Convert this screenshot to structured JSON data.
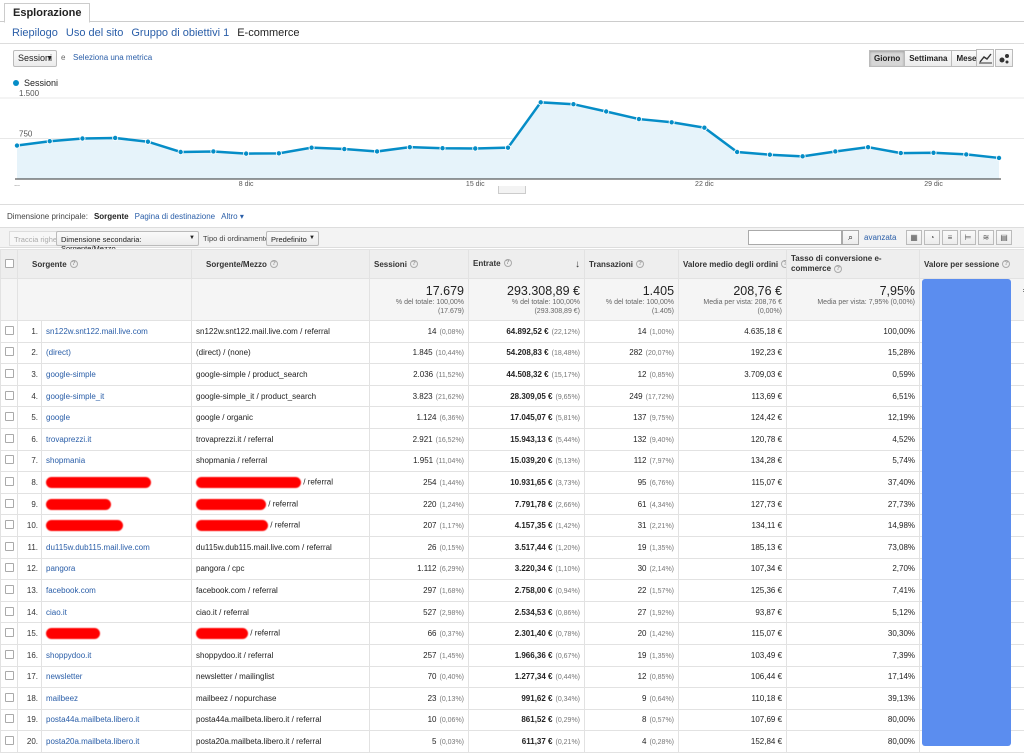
{
  "top_tab": "Esplorazione",
  "subtabs": [
    "Riepilogo",
    "Uso del sito",
    "Gruppo di obiettivi 1",
    "E-commerce"
  ],
  "metric_select": "Sessioni",
  "vs": "e",
  "select_metric_link": "Seleziona una metrica",
  "period_buttons": [
    "Giorno",
    "Settimana",
    "Mese"
  ],
  "legend_label": "Sessioni",
  "colors": {
    "series": "#058dc7",
    "area": "#e6f3fa",
    "link": "#2a5ea8",
    "redaction": "#ff0000",
    "overlay": "#5b8def"
  },
  "icons": {
    "line_chart": "line-chart-icon",
    "motion_chart": "motion-chart-icon",
    "search": "search-icon"
  },
  "chart_data": {
    "type": "area",
    "ytick_labels": [
      "1.500",
      "750"
    ],
    "ylim": [
      0,
      1500
    ],
    "xtick_labels": [
      "...",
      "8 dic",
      "15 dic",
      "22 dic",
      "29 dic"
    ],
    "series": [
      {
        "name": "Sessioni",
        "values": [
          620,
          700,
          750,
          760,
          690,
          500,
          510,
          470,
          475,
          580,
          555,
          510,
          590,
          570,
          565,
          580,
          1420,
          1385,
          1250,
          1110,
          1050,
          950,
          500,
          450,
          420,
          510,
          590,
          480,
          485,
          455,
          390
        ]
      }
    ]
  },
  "dimension_row": {
    "label": "Dimensione principale:",
    "current": "Sorgente",
    "other": "Pagina di destinazione",
    "more": "Altro"
  },
  "toolbar": {
    "plot_rows": "Traccia righe",
    "secondary_dim": "Dimensione secondaria: Sorgente/Mezzo",
    "sort_label": "Tipo di ordinamento:",
    "sort_value": "Predefinito",
    "advanced": "avanzata"
  },
  "table": {
    "headers": [
      "Sorgente",
      "Sorgente/Mezzo",
      "Sessioni",
      "Entrate",
      "Transazioni",
      "Valore medio degli ordini",
      "Tasso di conversione e-commerce",
      "Valore per sessione"
    ],
    "totals": {
      "sessions": "17.679",
      "sessions_sub": "% del totale: 100,00%",
      "sessions_sub2": "(17.679)",
      "revenue": "293.308,89 €",
      "revenue_sub": "% del totale: 100,00%",
      "revenue_sub2": "(293.308,89 €)",
      "transactions": "1.405",
      "transactions_sub": "% del totale: 100,00%",
      "transactions_sub2": "(1.405)",
      "aov": "208,76 €",
      "aov_sub": "Media per vista: 208,76 €",
      "aov_sub2": "(0,00%)",
      "conv": "7,95%",
      "conv_sub": "Media per vista: 7,95% (0,00%)",
      "value_edge": "€",
      "value_edge_sub": "%"
    },
    "rows": [
      {
        "idx": "1.",
        "source": "sn122w.snt122.mail.live.com",
        "medium": "sn122w.snt122.mail.live.com / referral",
        "ses": "14",
        "sesp": "(0,08%)",
        "rev": "64.892,52 €",
        "revp": "(22,12%)",
        "tr": "14",
        "trp": "(1,00%)",
        "aov": "4.635,18 €",
        "conv": "100,00%",
        "edge": "€"
      },
      {
        "idx": "2.",
        "source": "(direct)",
        "medium": "(direct) / (none)",
        "ses": "1.845",
        "sesp": "(10,44%)",
        "rev": "54.208,83 €",
        "revp": "(18,48%)",
        "tr": "282",
        "trp": "(20,07%)",
        "aov": "192,23 €",
        "conv": "15,28%",
        "edge": "€"
      },
      {
        "idx": "3.",
        "source": "google-simple",
        "medium": "google-simple / product_search",
        "ses": "2.036",
        "sesp": "(11,52%)",
        "rev": "44.508,32 €",
        "revp": "(15,17%)",
        "tr": "12",
        "trp": "(0,85%)",
        "aov": "3.709,03 €",
        "conv": "0,59%",
        "edge": "€"
      },
      {
        "idx": "4.",
        "source": "google-simple_it",
        "medium": "google-simple_it / product_search",
        "ses": "3.823",
        "sesp": "(21,62%)",
        "rev": "28.309,05 €",
        "revp": "(9,65%)",
        "tr": "249",
        "trp": "(17,72%)",
        "aov": "113,69 €",
        "conv": "6,51%",
        "edge": "€"
      },
      {
        "idx": "5.",
        "source": "google",
        "medium": "google / organic",
        "ses": "1.124",
        "sesp": "(6,36%)",
        "rev": "17.045,07 €",
        "revp": "(5,81%)",
        "tr": "137",
        "trp": "(9,75%)",
        "aov": "124,42 €",
        "conv": "12,19%",
        "edge": "€"
      },
      {
        "idx": "6.",
        "source": "trovaprezzi.it",
        "medium": "trovaprezzi.it / referral",
        "ses": "2.921",
        "sesp": "(16,52%)",
        "rev": "15.943,13 €",
        "revp": "(5,44%)",
        "tr": "132",
        "trp": "(9,40%)",
        "aov": "120,78 €",
        "conv": "4,52%",
        "edge": "€"
      },
      {
        "idx": "7.",
        "source": "shopmania",
        "medium": "shopmania / referral",
        "ses": "1.951",
        "sesp": "(11,04%)",
        "rev": "15.039,20 €",
        "revp": "(5,13%)",
        "tr": "112",
        "trp": "(7,97%)",
        "aov": "134,28 €",
        "conv": "5,74%",
        "edge": "€"
      },
      {
        "idx": "8.",
        "source": "",
        "medium": "/ referral",
        "ses": "254",
        "sesp": "(1,44%)",
        "rev": "10.931,65 €",
        "revp": "(3,73%)",
        "tr": "95",
        "trp": "(6,76%)",
        "aov": "115,07 €",
        "conv": "37,40%",
        "edge": "€"
      },
      {
        "idx": "9.",
        "source": "",
        "medium": "/ referral",
        "ses": "220",
        "sesp": "(1,24%)",
        "rev": "7.791,78 €",
        "revp": "(2,66%)",
        "tr": "61",
        "trp": "(4,34%)",
        "aov": "127,73 €",
        "conv": "27,73%",
        "edge": "€"
      },
      {
        "idx": "10.",
        "source": "",
        "medium": "/ referral",
        "ses": "207",
        "sesp": "(1,17%)",
        "rev": "4.157,35 €",
        "revp": "(1,42%)",
        "tr": "31",
        "trp": "(2,21%)",
        "aov": "134,11 €",
        "conv": "14,98%",
        "edge": "€"
      },
      {
        "idx": "11.",
        "source": "du115w.dub115.mail.live.com",
        "medium": "du115w.dub115.mail.live.com / referral",
        "ses": "26",
        "sesp": "(0,15%)",
        "rev": "3.517,44 €",
        "revp": "(1,20%)",
        "tr": "19",
        "trp": "(1,35%)",
        "aov": "185,13 €",
        "conv": "73,08%",
        "edge": "€"
      },
      {
        "idx": "12.",
        "source": "pangora",
        "medium": "pangora / cpc",
        "ses": "1.112",
        "sesp": "(6,29%)",
        "rev": "3.220,34 €",
        "revp": "(1,10%)",
        "tr": "30",
        "trp": "(2,14%)",
        "aov": "107,34 €",
        "conv": "2,70%",
        "edge": "€"
      },
      {
        "idx": "13.",
        "source": "facebook.com",
        "medium": "facebook.com / referral",
        "ses": "297",
        "sesp": "(1,68%)",
        "rev": "2.758,00 €",
        "revp": "(0,94%)",
        "tr": "22",
        "trp": "(1,57%)",
        "aov": "125,36 €",
        "conv": "7,41%",
        "edge": "€"
      },
      {
        "idx": "14.",
        "source": "ciao.it",
        "medium": "ciao.it / referral",
        "ses": "527",
        "sesp": "(2,98%)",
        "rev": "2.534,53 €",
        "revp": "(0,86%)",
        "tr": "27",
        "trp": "(1,92%)",
        "aov": "93,87 €",
        "conv": "5,12%",
        "edge": "€"
      },
      {
        "idx": "15.",
        "source": "",
        "medium": "/ referral",
        "ses": "66",
        "sesp": "(0,37%)",
        "rev": "2.301,40 €",
        "revp": "(0,78%)",
        "tr": "20",
        "trp": "(1,42%)",
        "aov": "115,07 €",
        "conv": "30,30%",
        "edge": "€"
      },
      {
        "idx": "16.",
        "source": "shoppydoo.it",
        "medium": "shoppydoo.it / referral",
        "ses": "257",
        "sesp": "(1,45%)",
        "rev": "1.966,36 €",
        "revp": "(0,67%)",
        "tr": "19",
        "trp": "(1,35%)",
        "aov": "103,49 €",
        "conv": "7,39%",
        "edge": "€"
      },
      {
        "idx": "17.",
        "source": "newsletter",
        "medium": "newsletter / mailinglist",
        "ses": "70",
        "sesp": "(0,40%)",
        "rev": "1.277,34 €",
        "revp": "(0,44%)",
        "tr": "12",
        "trp": "(0,85%)",
        "aov": "106,44 €",
        "conv": "17,14%",
        "edge": "€"
      },
      {
        "idx": "18.",
        "source": "mailbeez",
        "medium": "mailbeez / nopurchase",
        "ses": "23",
        "sesp": "(0,13%)",
        "rev": "991,62 €",
        "revp": "(0,34%)",
        "tr": "9",
        "trp": "(0,64%)",
        "aov": "110,18 €",
        "conv": "39,13%",
        "edge": "€"
      },
      {
        "idx": "19.",
        "source": "posta44a.mailbeta.libero.it",
        "medium": "posta44a.mailbeta.libero.it / referral",
        "ses": "10",
        "sesp": "(0,06%)",
        "rev": "861,52 €",
        "revp": "(0,29%)",
        "tr": "8",
        "trp": "(0,57%)",
        "aov": "107,69 €",
        "conv": "80,00%",
        "edge": "€"
      },
      {
        "idx": "20.",
        "source": "posta20a.mailbeta.libero.it",
        "medium": "posta20a.mailbeta.libero.it / referral",
        "ses": "5",
        "sesp": "(0,03%)",
        "rev": "611,37 €",
        "revp": "(0,21%)",
        "tr": "4",
        "trp": "(0,28%)",
        "aov": "152,84 €",
        "conv": "80,00%",
        "edge": "€"
      }
    ]
  }
}
